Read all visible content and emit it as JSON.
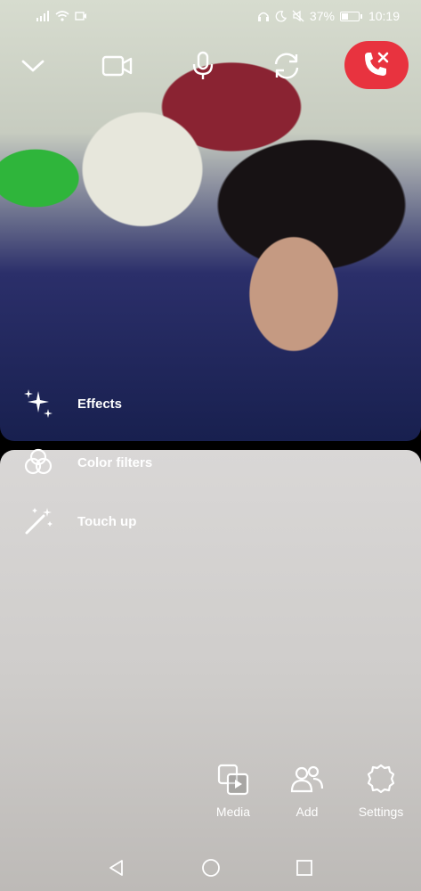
{
  "status_bar": {
    "battery_percent": "37%",
    "battery_level": 0.37,
    "time": "10:19",
    "icons": [
      "signal-icon",
      "wifi-icon",
      "media-icon",
      "headphones-icon",
      "moon-icon",
      "mute-icon",
      "battery-icon"
    ]
  },
  "call_controls": {
    "icons": [
      "chevron-down-icon",
      "video-camera-icon",
      "microphone-icon",
      "switch-camera-icon",
      "end-call-icon"
    ],
    "end_call_color": "#e8333f"
  },
  "effects_menu": {
    "items": [
      {
        "label": "Effects",
        "icon": "sparkles-icon"
      },
      {
        "label": "Color filters",
        "icon": "color-filters-icon"
      },
      {
        "label": "Touch up",
        "icon": "magic-wand-icon"
      }
    ]
  },
  "bottom_actions": {
    "items": [
      {
        "label": "Media",
        "icon": "media-icon"
      },
      {
        "label": "Add",
        "icon": "add-people-icon"
      },
      {
        "label": "Settings",
        "icon": "gear-icon"
      }
    ]
  },
  "nav_bar": {
    "icons": [
      "back-icon",
      "home-icon",
      "recents-icon"
    ]
  }
}
